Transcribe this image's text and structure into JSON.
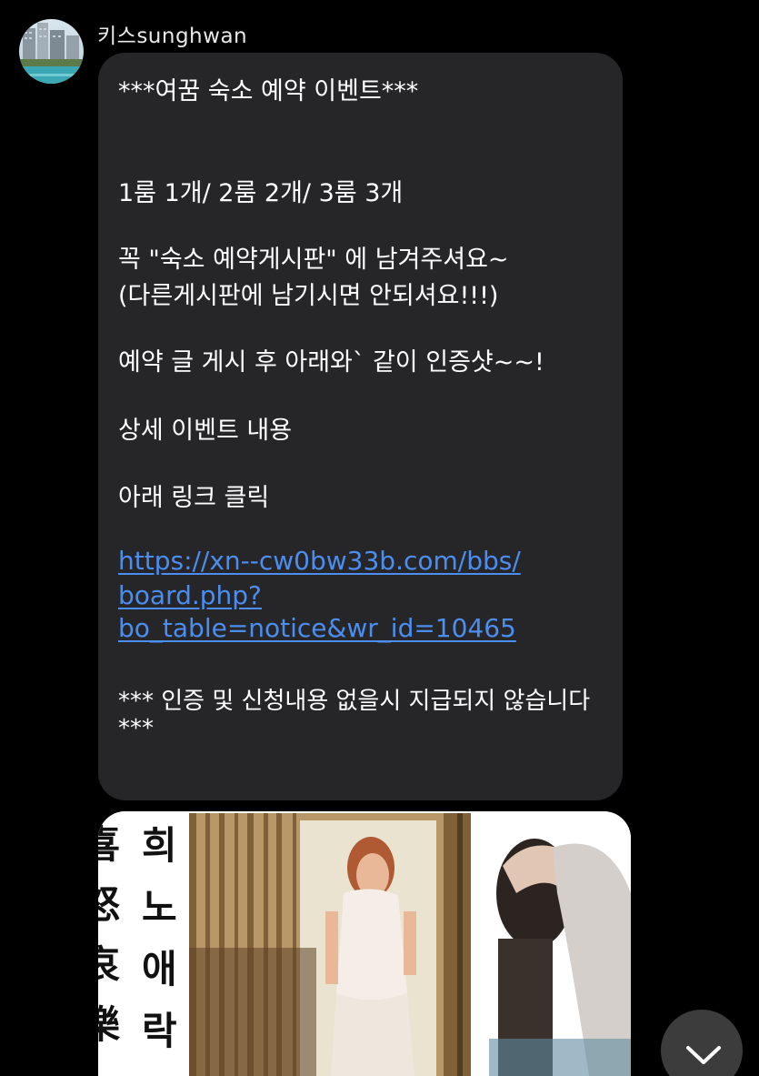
{
  "sender": {
    "name": "키스sunghwan",
    "avatar_icon": "profile-photo-pool-buildings"
  },
  "message": {
    "lines": [
      "***여꿈 숙소 예약 이벤트***",
      "1룸 1개/ 2룸 2개/ 3룸 3개",
      "꼭 \"숙소 예약게시판\" 에 남겨주셔요~",
      "(다른게시판에 남기시면 안되셔요!!!)",
      "예약 글 게시 후 아래와` 같이 인증샷~~!",
      "상세 이벤트 내용",
      "아래 링크 클릭"
    ],
    "link_lines": [
      "https://xn--cw0bw33b.com/bbs/",
      "board.php?",
      "bo_table=notice&wr_id=10465"
    ],
    "footer_lines": [
      "*** 인증 및 신청내용 없을시 지급되지 않습니다",
      "***"
    ],
    "bubble_color": "#262628",
    "link_color": "#4c8ef0"
  },
  "image_card": {
    "calligraphy_left": [
      "喜",
      "怒",
      "哀",
      "樂"
    ],
    "calligraphy_right": [
      "희",
      "노",
      "애",
      "락"
    ]
  },
  "scroll_button": {
    "icon": "chevron-down-icon"
  }
}
